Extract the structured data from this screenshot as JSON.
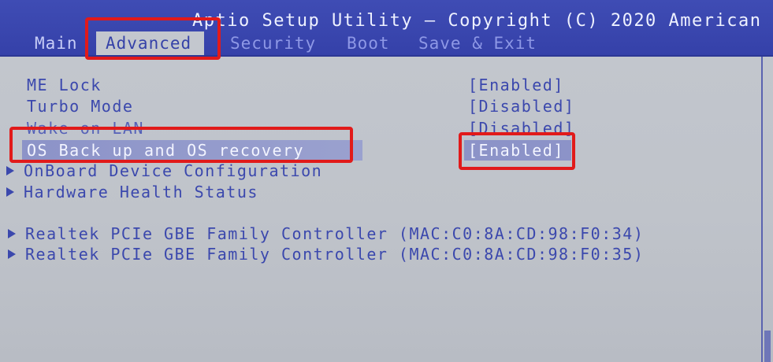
{
  "header": {
    "title": "Aptio Setup Utility – Copyright (C) 2020 American"
  },
  "tabs": [
    {
      "label": "Main"
    },
    {
      "label": "Advanced"
    },
    {
      "label": "Security"
    },
    {
      "label": "Boot"
    },
    {
      "label": "Save & Exit"
    }
  ],
  "settings": [
    {
      "label": "ME Lock",
      "value": "[Enabled]"
    },
    {
      "label": "Turbo Mode",
      "value": "[Disabled]"
    },
    {
      "label": "Wake on LAN",
      "value": "[Disabled]"
    },
    {
      "label": "OS Back up and OS recovery",
      "value": "[Enabled]"
    }
  ],
  "submenus": [
    {
      "label": "OnBoard Device Configuration"
    },
    {
      "label": "Hardware Health Status"
    },
    {
      "label": "Realtek PCIe GBE Family Controller (MAC:C0:8A:CD:98:F0:34)"
    },
    {
      "label": "Realtek PCIe GBE Family Controller (MAC:C0:8A:CD:98:F0:35)"
    }
  ],
  "colors": {
    "header_bg": "#3f4cb4",
    "body_bg": "#c3c7ce",
    "text": "#3b48ad",
    "highlight": "#e11a1a"
  }
}
